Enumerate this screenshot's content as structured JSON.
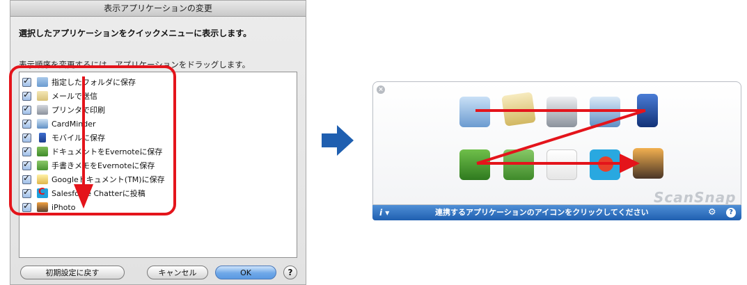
{
  "dialog": {
    "title": "表示アプリケーションの変更",
    "heading": "選択したアプリケーションをクイックメニューに表示します。",
    "hint": "表示順序を変更するには、アプリケーションをドラッグします。",
    "items": [
      {
        "label": "指定したフォルダに保存",
        "icon": "folder-icon",
        "checked": true
      },
      {
        "label": "メールで送信",
        "icon": "mail-icon",
        "checked": true
      },
      {
        "label": "プリンタで印刷",
        "icon": "printer-icon",
        "checked": true
      },
      {
        "label": "CardMinder",
        "icon": "cardminder-icon",
        "checked": true
      },
      {
        "label": "モバイルに保存",
        "icon": "mobile-icon",
        "checked": true
      },
      {
        "label": "ドキュメントをEvernoteに保存",
        "icon": "evernote-document-icon",
        "checked": true
      },
      {
        "label": "手書きメモをEvernoteに保存",
        "icon": "evernote-note-icon",
        "checked": true
      },
      {
        "label": "Googleドキュメント(TM)に保存",
        "icon": "google-docs-icon",
        "checked": true
      },
      {
        "label": "Salesforce Chatterに投稿",
        "icon": "salesforce-icon",
        "checked": true
      },
      {
        "label": "iPhoto",
        "icon": "iphoto-icon",
        "checked": true
      }
    ],
    "buttons": {
      "reset": "初期設定に戻す",
      "cancel": "キャンセル",
      "ok": "OK",
      "help": "?"
    }
  },
  "panel": {
    "brand": "ScanSnap",
    "message": "連携するアプリケーションのアイコンをクリックしてください",
    "info_label": "i ▾"
  },
  "colors": {
    "annotation": "#e4141b",
    "arrow": "#1f5fb0",
    "bar": "#2e6fc4"
  }
}
